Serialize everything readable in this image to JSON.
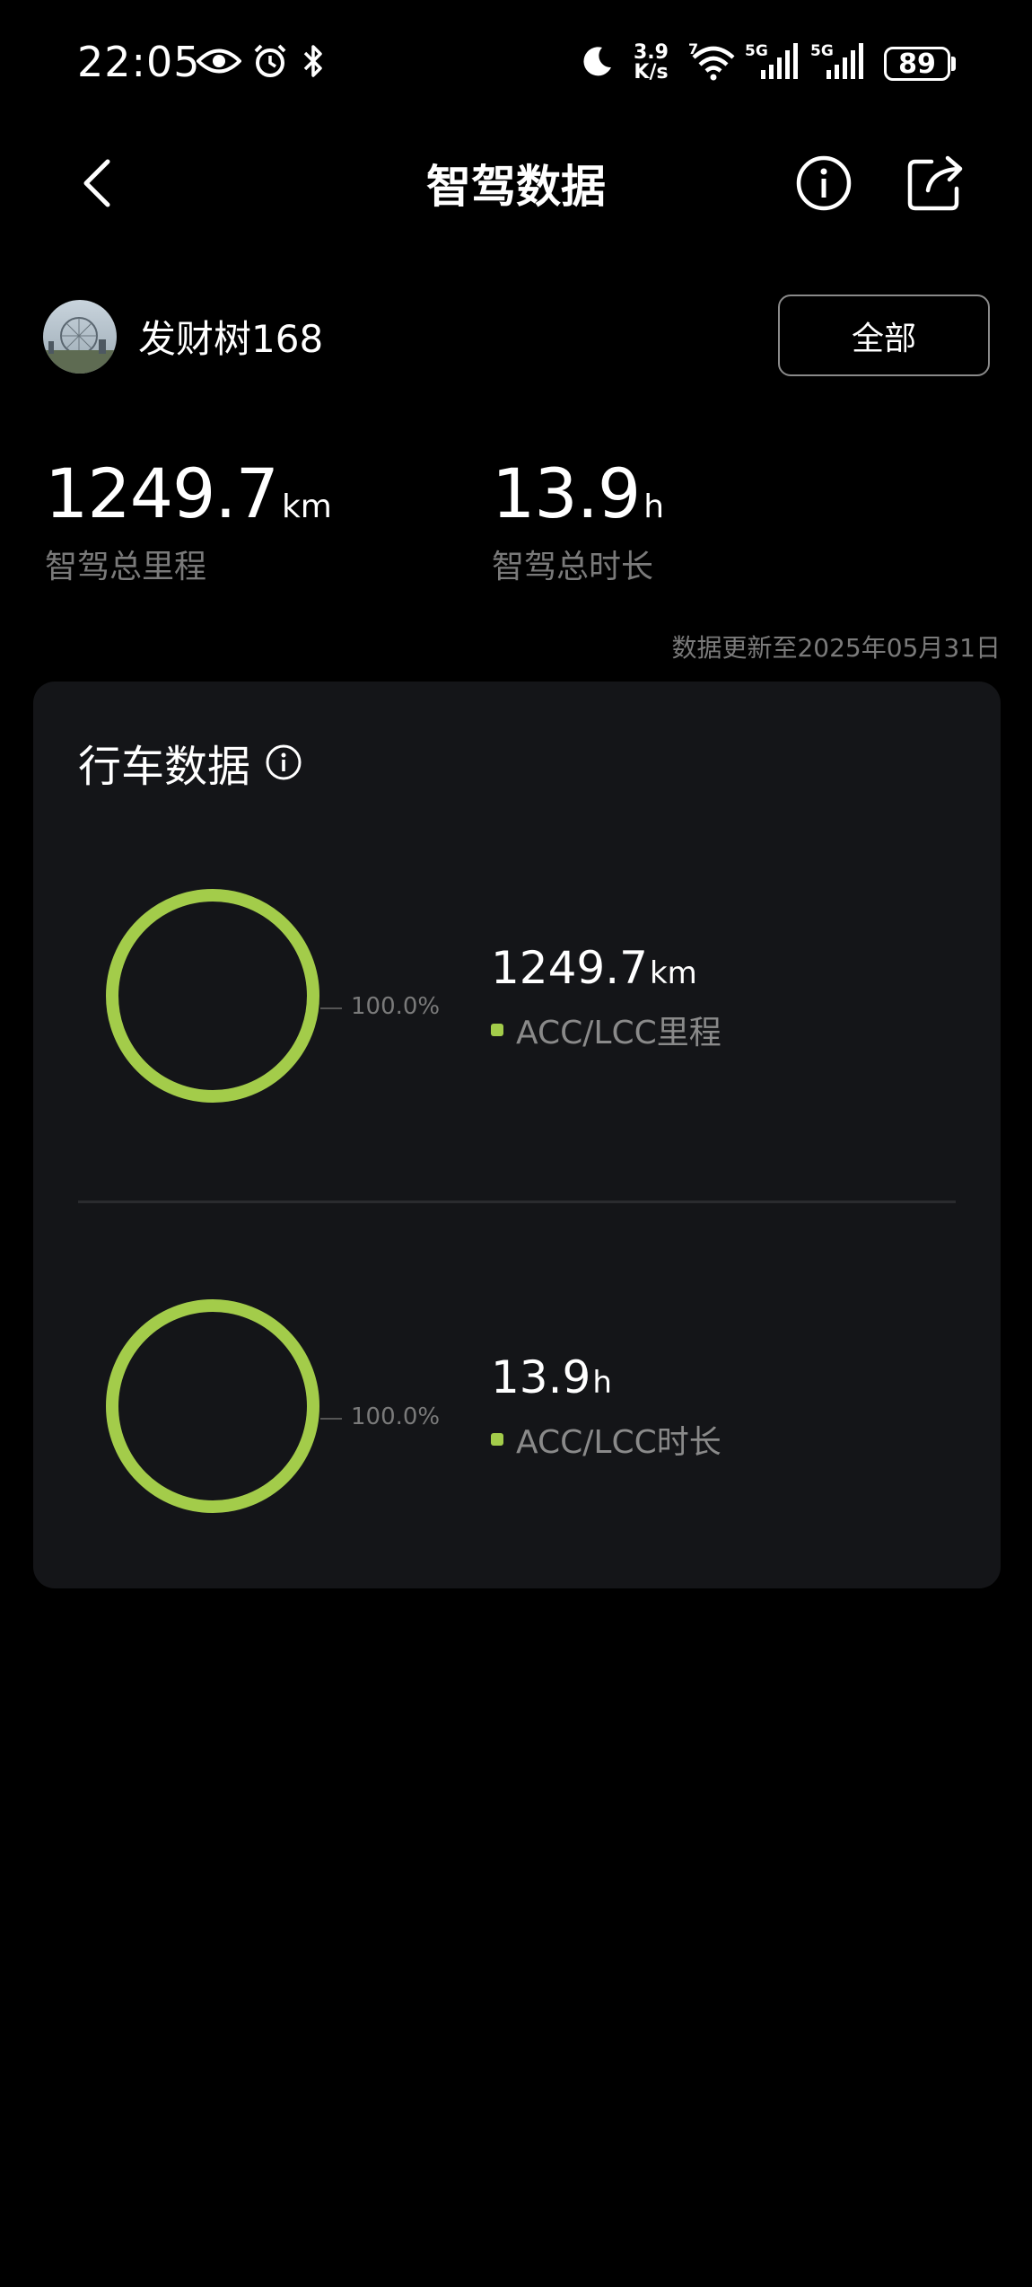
{
  "status_bar": {
    "time": "22:05",
    "net_speed_value": "3.9",
    "net_speed_unit": "K/s",
    "wifi_label": "7",
    "sim1_label": "5G",
    "sim2_label": "5G",
    "battery": "89",
    "icons": [
      "eye-icon",
      "alarm-icon",
      "bluetooth-icon",
      "moon-icon",
      "wifi-icon",
      "signal-icon",
      "signal-icon",
      "battery-icon"
    ]
  },
  "header": {
    "title": "智驾数据",
    "back_icon": "chevron-left-icon",
    "info_icon": "info-icon",
    "share_icon": "share-icon"
  },
  "user": {
    "name": "发财树168",
    "filter_label": "全部"
  },
  "totals": {
    "distance_value": "1249.7",
    "distance_unit": "km",
    "distance_label": "智驾总里程",
    "duration_value": "13.9",
    "duration_unit": "h",
    "duration_label": "智驾总时长",
    "update_note": "数据更新至2025年05月31日"
  },
  "driving_card": {
    "title": "行车数据",
    "info_icon": "info-icon",
    "accent_color": "#a3cc4a",
    "charts": [
      {
        "percent": 100.0,
        "percent_label": "100.0%",
        "value": "1249.7",
        "unit": "km",
        "legend": "ACC/LCC里程"
      },
      {
        "percent": 100.0,
        "percent_label": "100.0%",
        "value": "13.9",
        "unit": "h",
        "legend": "ACC/LCC时长"
      }
    ]
  }
}
